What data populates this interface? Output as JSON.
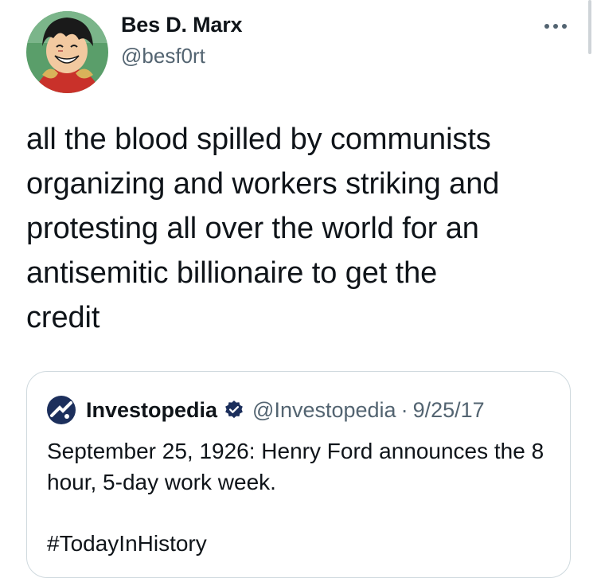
{
  "author": {
    "display_name": "Bes D. Marx",
    "handle": "@besf0rt",
    "avatar_icon": "anime-character-avatar"
  },
  "more_icon": "more-horizontal-icon",
  "tweet": {
    "text": "all the blood spilled by communists\norganizing and workers striking and\nprotesting all over the world for an\nantisemitic billionaire to get the\ncredit"
  },
  "quoted_tweet": {
    "logo_icon": "investopedia-logo-icon",
    "display_name": "Investopedia",
    "verified_icon": "verified-badge-icon",
    "handle": "@Investopedia",
    "separator": "·",
    "date": "9/25/17",
    "text": "September 25, 1926: Henry Ford announces the 8 hour, 5-day work week.",
    "hashtag": "#TodayInHistory"
  },
  "colors": {
    "text_primary": "#0f1419",
    "text_secondary": "#536471",
    "border": "#cfd9de",
    "verified_blue": "#1d9bf0",
    "investopedia_navy": "#1c2f5c"
  }
}
